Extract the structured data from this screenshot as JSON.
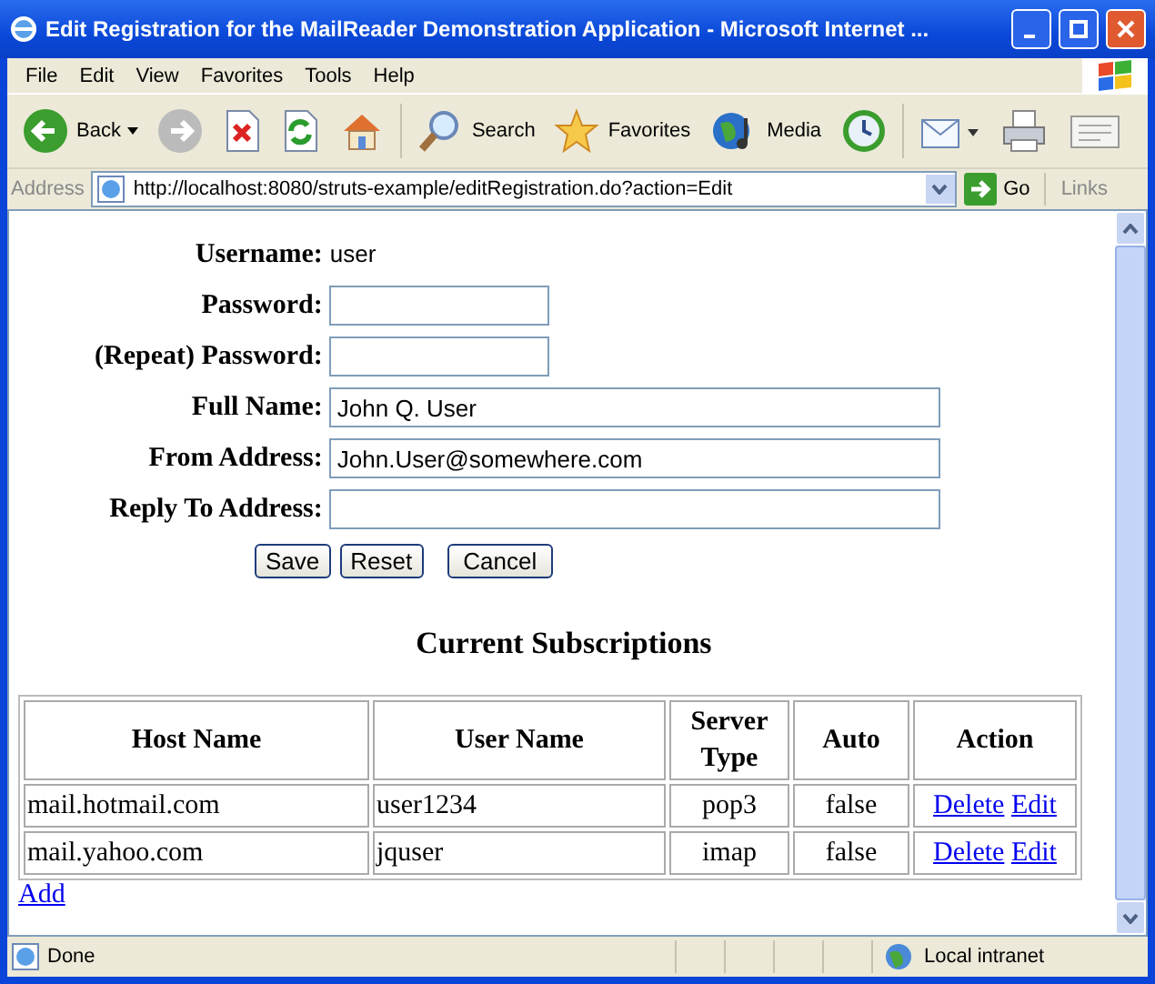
{
  "window": {
    "title": "Edit Registration for the MailReader Demonstration Application - Microsoft Internet ..."
  },
  "menu": [
    "File",
    "Edit",
    "View",
    "Favorites",
    "Tools",
    "Help"
  ],
  "toolbar": [
    {
      "kind": "back",
      "label": "Back"
    },
    {
      "kind": "forward",
      "disabled": true
    },
    {
      "kind": "stop"
    },
    {
      "kind": "refresh"
    },
    {
      "kind": "home"
    },
    {
      "kind": "search",
      "label": "Search"
    },
    {
      "kind": "favorites",
      "label": "Favorites"
    },
    {
      "kind": "media",
      "label": "Media"
    },
    {
      "kind": "history"
    },
    {
      "kind": "mail"
    },
    {
      "kind": "print"
    },
    {
      "kind": "edit"
    }
  ],
  "address_bar": {
    "label": "Address",
    "url": "http://localhost:8080/struts-example/editRegistration.do?action=Edit",
    "go": "Go",
    "links": "Links"
  },
  "form": {
    "fields": [
      {
        "label": "Username:",
        "kind": "text",
        "value": "user"
      },
      {
        "label": "Password:",
        "kind": "short"
      },
      {
        "label": "(Repeat) Password:",
        "kind": "short"
      },
      {
        "label": "Full Name:",
        "kind": "long",
        "value": "John Q. User"
      },
      {
        "label": "From Address:",
        "kind": "long",
        "value": "John.User@somewhere.com"
      },
      {
        "label": "Reply To Address:",
        "kind": "long"
      }
    ],
    "buttons": [
      "Save",
      "Reset",
      "Cancel"
    ]
  },
  "subscriptions": {
    "heading": "Current Subscriptions",
    "columns": [
      "Host Name",
      "User Name",
      "Server Type",
      "Auto",
      "Action"
    ],
    "rows": [
      {
        "host": "mail.hotmail.com",
        "user": "user1234",
        "type": "pop3",
        "auto": "false",
        "actions": [
          "Delete",
          "Edit"
        ]
      },
      {
        "host": "mail.yahoo.com",
        "user": "jquser",
        "type": "imap",
        "auto": "false",
        "actions": [
          "Delete",
          "Edit"
        ]
      }
    ],
    "add_link": "Add"
  },
  "status_bar": {
    "text": "Done",
    "zone": "Local intranet"
  }
}
